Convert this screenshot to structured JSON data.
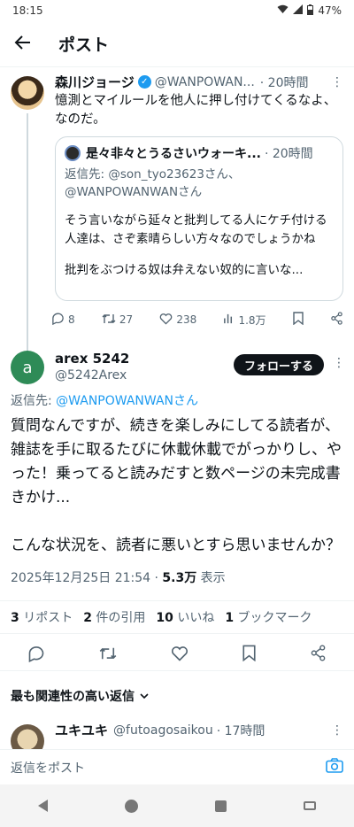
{
  "status_bar": {
    "time": "18:15",
    "battery": "47%"
  },
  "header": {
    "title": "ポスト"
  },
  "parent_post": {
    "author_name": "森川ジョージ",
    "handle": "@WANPOWAN...",
    "time": "· 20時間",
    "text": "憶測とマイルールを他人に押し付けてくるなよ、なのだ。",
    "quote": {
      "author_name": "是々非々とうるさいウォーキ...",
      "time": "· 20時間",
      "reply_to": "返信先: @son_tyo23623さん、@WANPOWANWANさん",
      "text1": "そう言いながら延々と批判してる人にケチ付ける人達は、さぞ素晴らしい方々なのでしょうかね",
      "text2": "批判をぶつける奴は弁えない奴的に言いな..."
    },
    "actions": {
      "replies": "8",
      "reposts": "27",
      "likes": "238",
      "views": "1.8万"
    }
  },
  "main_post": {
    "avatar_letter": "a",
    "author_name": "arex 5242",
    "handle": "@5242Arex",
    "follow_label": "フォローする",
    "reply_prefix": "返信先: ",
    "reply_handle": "@WANPOWANWANさん",
    "text_p1": "質問なんですが、続きを楽しみにしてる読者が、雑誌を手に取るたびに休載休載でがっかりし、やった！乗ってると読みだすと数ページの未完成書きかけ...",
    "text_p2": "こんな状況を、読者に悪いとすら思いませんか？",
    "date": "2025年12月25日 21:54 · ",
    "views_count": "5.3万",
    "views_label": " 表示"
  },
  "stats": {
    "reposts_count": "3",
    "reposts_label": "リポスト",
    "quotes_count": "2",
    "quotes_label": "件の引用",
    "likes_count": "10",
    "likes_label": "いいね",
    "bookmarks_count": "1",
    "bookmarks_label": "ブックマーク"
  },
  "replies_section": {
    "sort_label": "最も関連性の高い返信"
  },
  "reply_item": {
    "author_name": "ユキユキ",
    "handle": "@futoagosaikou",
    "time": "· 17時間"
  },
  "compose": {
    "placeholder": "返信をポスト"
  },
  "colors": {
    "accent": "#1d9bf0",
    "text": "#0f1419",
    "muted": "#536471",
    "border": "#cfd9de"
  }
}
